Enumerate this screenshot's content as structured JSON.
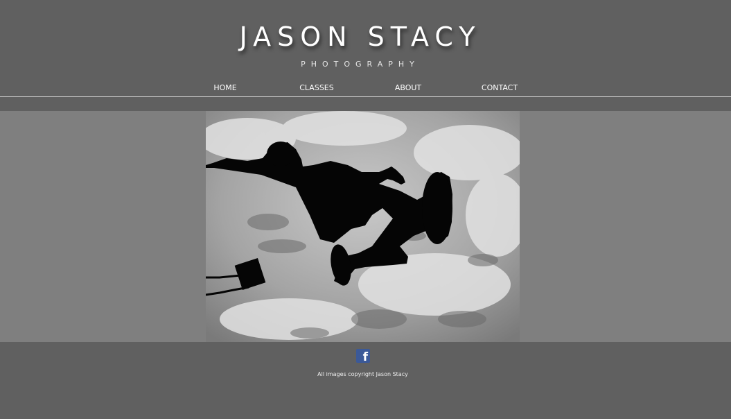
{
  "header": {
    "title": "JASON STACY",
    "subtitle": "PHOTOGRAPHY"
  },
  "nav": {
    "items": [
      {
        "label": "HOME"
      },
      {
        "label": "CLASSES"
      },
      {
        "label": "ABOUT"
      },
      {
        "label": "CONTACT"
      }
    ]
  },
  "hero": {
    "image_subject": "silhouette of person leaping from a swing against a cloudy sky, black and white"
  },
  "footer": {
    "social_icon": "facebook-icon",
    "social_icon_glyph": "f",
    "copyright": "All images copyright Jason Stacy"
  },
  "colors": {
    "page_background": "#606060",
    "hero_band": "#7f7f7f",
    "text": "#ffffff",
    "facebook_blue": "#3b5998"
  }
}
